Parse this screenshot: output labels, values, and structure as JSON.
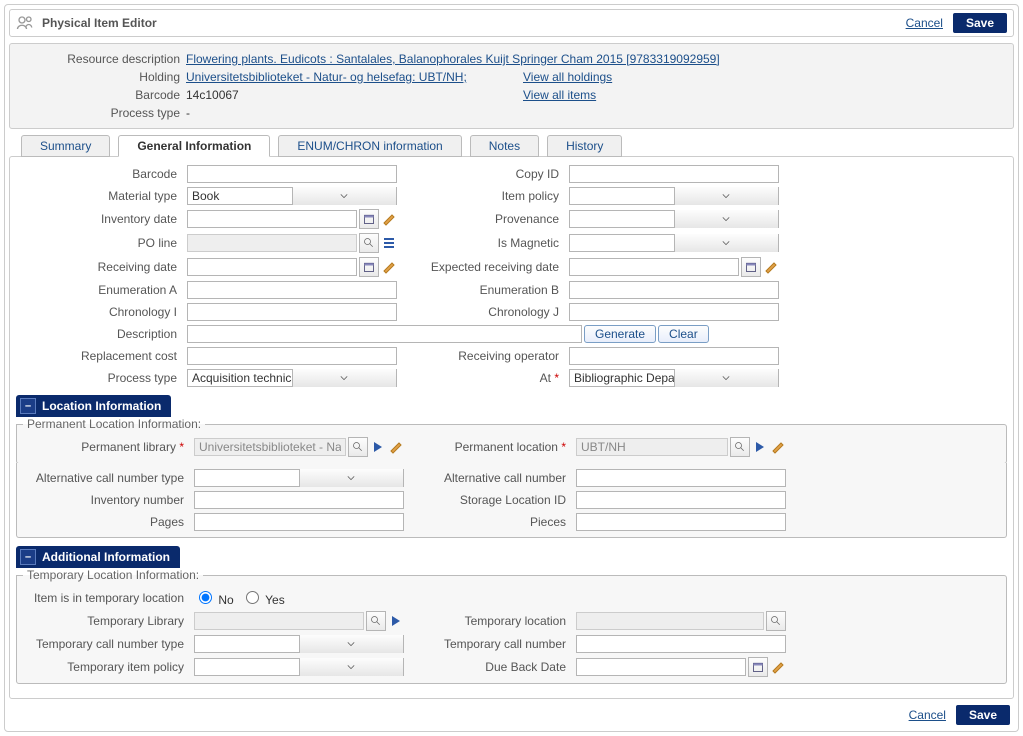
{
  "title": "Physical Item Editor",
  "actions": {
    "cancel": "Cancel",
    "save": "Save"
  },
  "header": {
    "resource_description_label": "Resource description",
    "resource_description_value": "Flowering plants. Eudicots : Santalales, Balanophorales Kuijt Springer Cham 2015 [9783319092959]",
    "holding_label": "Holding",
    "holding_value": "Universitetsbiblioteket - Natur- og helsefag: UBT/NH;",
    "barcode_label": "Barcode",
    "barcode_value": "14c10067",
    "process_type_label": "Process type",
    "process_type_value": "-",
    "view_all_holdings": "View all holdings",
    "view_all_items": "View all items"
  },
  "tabs": {
    "summary": "Summary",
    "general": "General Information",
    "enum": "ENUM/CHRON information",
    "notes": "Notes",
    "history": "History"
  },
  "general": {
    "barcode": "Barcode",
    "copy_id": "Copy ID",
    "material_type": "Material type",
    "material_type_value": "Book",
    "item_policy": "Item policy",
    "inventory_date": "Inventory date",
    "provenance": "Provenance",
    "po_line": "PO line",
    "is_magnetic": "Is Magnetic",
    "receiving_date": "Receiving date",
    "expected_receiving_date": "Expected receiving date",
    "enumeration_a": "Enumeration A",
    "enumeration_b": "Enumeration B",
    "chronology_i": "Chronology I",
    "chronology_j": "Chronology J",
    "description": "Description",
    "generate": "Generate",
    "clear": "Clear",
    "replacement_cost": "Replacement cost",
    "receiving_operator": "Receiving operator",
    "process_type": "Process type",
    "process_type_value": "Acquisition technical services",
    "at": "At",
    "at_value": "Bibliographic Department"
  },
  "location": {
    "section_title": "Location Information",
    "legend": "Permanent Location Information:",
    "permanent_library": "Permanent library",
    "permanent_library_value": "Universitetsbiblioteket - Natur-",
    "permanent_location": "Permanent location",
    "permanent_location_value": "UBT/NH",
    "alt_call_type": "Alternative call number type",
    "alt_call_number": "Alternative call number",
    "inventory_number": "Inventory number",
    "storage_location_id": "Storage Location ID",
    "pages": "Pages",
    "pieces": "Pieces"
  },
  "additional": {
    "section_title": "Additional Information",
    "legend": "Temporary Location Information:",
    "item_in_temp": "Item is in temporary location",
    "no": "No",
    "yes": "Yes",
    "temp_library": "Temporary Library",
    "temp_location": "Temporary location",
    "temp_call_type": "Temporary call number type",
    "temp_call_number": "Temporary call number",
    "temp_item_policy": "Temporary item policy",
    "due_back_date": "Due Back Date"
  }
}
